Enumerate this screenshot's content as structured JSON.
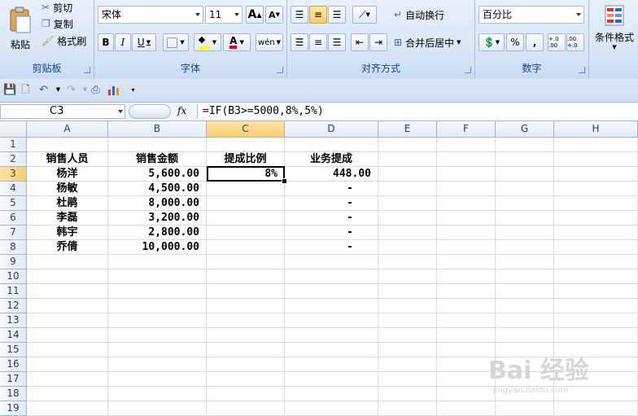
{
  "ribbon": {
    "clipboard": {
      "paste": "粘贴",
      "cut": "剪切",
      "copy": "复制",
      "format_painter": "格式刷",
      "label": "剪贴板"
    },
    "font": {
      "name": "宋体",
      "size": "11",
      "grow": "A",
      "shrink": "A",
      "bold": "B",
      "italic": "I",
      "underline": "U",
      "phonetic": "wén",
      "label": "字体"
    },
    "alignment": {
      "wrap": "自动换行",
      "merge": "合并后居中",
      "label": "对齐方式"
    },
    "number": {
      "format": "百分比",
      "percent": "%",
      "comma": ",",
      "inc_dec": "+.0 .00",
      "dec_dec": ".00 +.0",
      "label": "数字"
    },
    "styles": {
      "conditional": "条件格式"
    }
  },
  "formula_bar": {
    "name_box": "C3",
    "fx": "fx",
    "formula": "=IF(B3>=5000,8%,5%)"
  },
  "columns": [
    "A",
    "B",
    "C",
    "D",
    "E",
    "F",
    "G",
    "H"
  ],
  "rows": [
    "1",
    "2",
    "3",
    "4",
    "5",
    "6",
    "7",
    "8",
    "9",
    "10",
    "11",
    "12",
    "13",
    "14",
    "15",
    "16",
    "17",
    "18",
    "19"
  ],
  "sheet": {
    "headers": {
      "a": "销售人员",
      "b": "销售金额",
      "c": "提成比例",
      "d": "业务提成"
    },
    "data": [
      {
        "name": "杨洋",
        "amount": "5,600.00",
        "rate": "8%",
        "commission": "448.00"
      },
      {
        "name": "杨敏",
        "amount": "4,500.00",
        "rate": "",
        "commission": "-"
      },
      {
        "name": "杜鹃",
        "amount": "8,000.00",
        "rate": "",
        "commission": "-"
      },
      {
        "name": "李磊",
        "amount": "3,200.00",
        "rate": "",
        "commission": "-"
      },
      {
        "name": "韩宇",
        "amount": "2,800.00",
        "rate": "",
        "commission": "-"
      },
      {
        "name": "乔倩",
        "amount": "10,000.00",
        "rate": "",
        "commission": "-"
      }
    ]
  },
  "watermark": {
    "text": "Bai 经验",
    "sub": "jingyan.baidu.com"
  }
}
